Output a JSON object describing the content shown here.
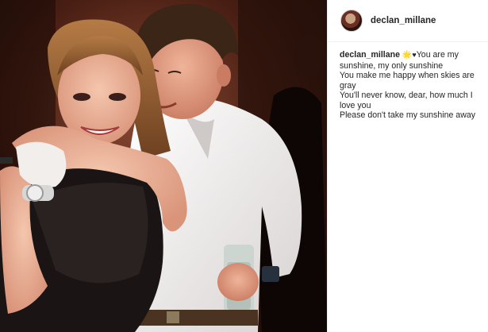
{
  "post": {
    "username": "declan_millane",
    "caption": {
      "username": "declan_millane",
      "sun_emoji": "🌟",
      "heart_emoji": "♥",
      "first_line": "You are my sunshine, my only sunshine",
      "lines": [
        "You make me happy when skies are gray",
        "You'll never know, dear, how much I love you",
        "Please don't take my sunshine away"
      ]
    }
  },
  "icons": {
    "avatar": "profile-avatar",
    "photo": "couple-photo"
  },
  "colors": {
    "username": "#262626",
    "caption_text": "#262626",
    "panel_bg": "#ffffff",
    "divider": "#efefef",
    "sun_emoji": "#e8c21d"
  }
}
